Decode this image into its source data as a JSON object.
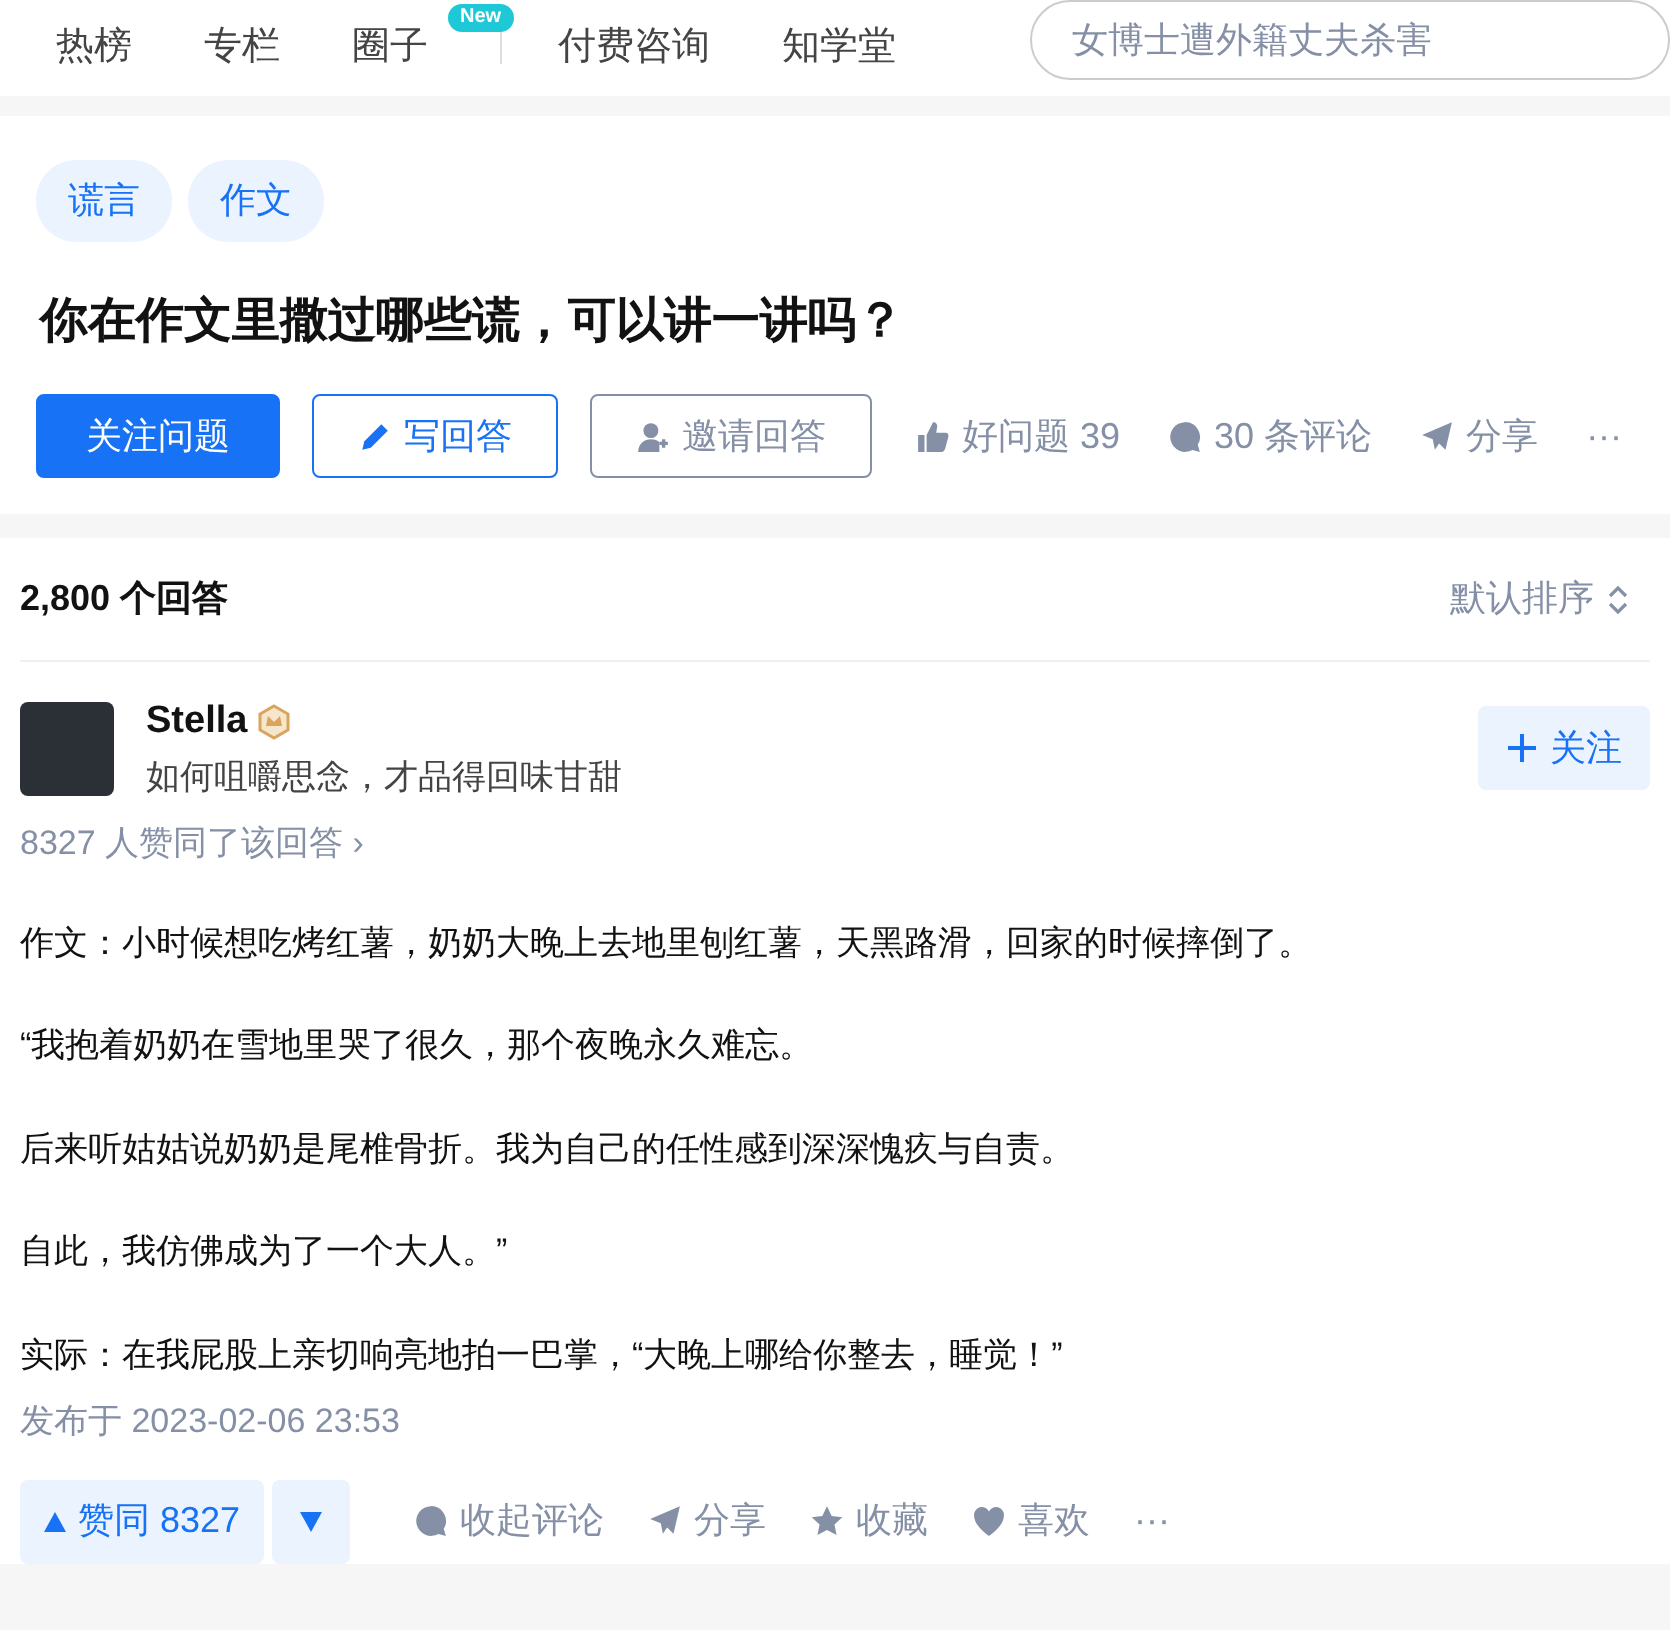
{
  "nav": {
    "items": [
      {
        "label": "热榜"
      },
      {
        "label": "专栏"
      },
      {
        "label": "圈子",
        "badge": "New"
      },
      {
        "label": "付费咨询"
      },
      {
        "label": "知学堂"
      }
    ],
    "search": {
      "placeholder": "女博士遭外籍丈夫杀害"
    }
  },
  "question": {
    "tags": [
      "谎言",
      "作文"
    ],
    "title": "你在作文里撒过哪些谎，可以讲一讲吗？",
    "buttons": [
      {
        "kind": "primary",
        "label": "关注问题"
      },
      {
        "kind": "outline",
        "label": "写回答"
      },
      {
        "kind": "grey",
        "label": "邀请回答"
      }
    ],
    "actions": [
      "好问题 39",
      "30 条评论",
      "分享",
      "···"
    ]
  },
  "answers": {
    "count": "2,800 个回答",
    "sort": "默认排序",
    "answer": {
      "author": "Stella",
      "bio": "如何咀嚼思念，才品得回味甘甜",
      "follow": "关注",
      "votes_line": "8327 人赞同了该回答 ›",
      "paragraphs": [
        "作文：小时候想吃烤红薯，奶奶大晚上去地里刨红薯，天黑路滑，回家的时候摔倒了。",
        "“我抱着奶奶在雪地里哭了很久，那个夜晚永久难忘。",
        "后来听姑姑说奶奶是尾椎骨折。我为自己的任性感到深深愧疚与自责。",
        "自此，我仿佛成为了一个大人。”",
        "实际：在我屁股上亲切响亮地拍一巴掌，“大晚上哪给你整去，睡觉！”"
      ],
      "date": "发布于 2023-02-06 23:53",
      "upvote": "赞同 8327",
      "actions": [
        "收起评论",
        "分享",
        "收藏",
        "喜欢",
        "···"
      ]
    }
  }
}
